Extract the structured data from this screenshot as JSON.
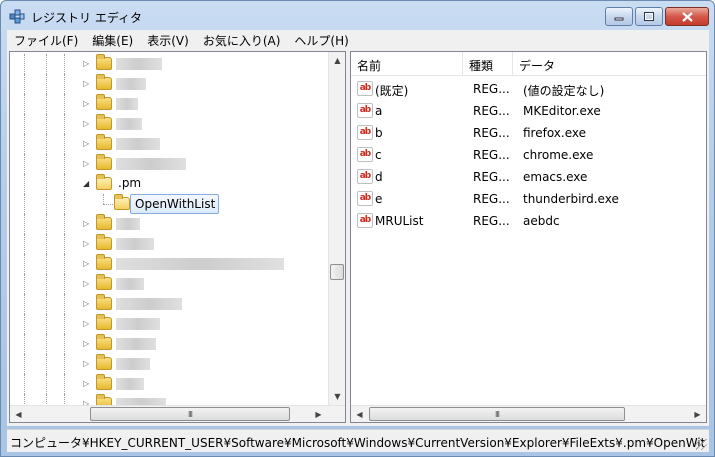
{
  "window": {
    "title": "レジストリ エディタ",
    "icon": "registry-editor-icon"
  },
  "menu": [
    "ファイル(F)",
    "編集(E)",
    "表示(V)",
    "お気に入り(A)",
    "ヘルプ(H)"
  ],
  "tree": {
    "expanded_key": ".pm",
    "selected_key": "OpenWithList",
    "obscured_rows_above": 6,
    "obscured_rows_below": 10,
    "vertical_scroll_fraction": 0.62
  },
  "list": {
    "columns": [
      "名前",
      "種類",
      "データ"
    ],
    "rows": [
      {
        "name": "(既定)",
        "type": "REG...",
        "data": "(値の設定なし)"
      },
      {
        "name": "a",
        "type": "REG...",
        "data": "MKEditor.exe"
      },
      {
        "name": "b",
        "type": "REG...",
        "data": "firefox.exe"
      },
      {
        "name": "c",
        "type": "REG...",
        "data": "chrome.exe"
      },
      {
        "name": "d",
        "type": "REG...",
        "data": "emacs.exe"
      },
      {
        "name": "e",
        "type": "REG...",
        "data": "thunderbird.exe"
      },
      {
        "name": "MRUList",
        "type": "REG...",
        "data": "aebdc"
      }
    ],
    "value_icon_text": "ab"
  },
  "status": {
    "path": "コンピュータ¥HKEY_CURRENT_USER¥Software¥Microsoft¥Windows¥CurrentVersion¥Explorer¥FileExts¥.pm¥OpenWit"
  },
  "scrollbars": {
    "arrow_up": "▲",
    "arrow_down": "▼",
    "arrow_left": "◀",
    "arrow_right": "▶",
    "thumb_grip": "III"
  },
  "colors": {
    "selection_border": "#84acdd",
    "value_icon_red": "#d02a1d"
  }
}
